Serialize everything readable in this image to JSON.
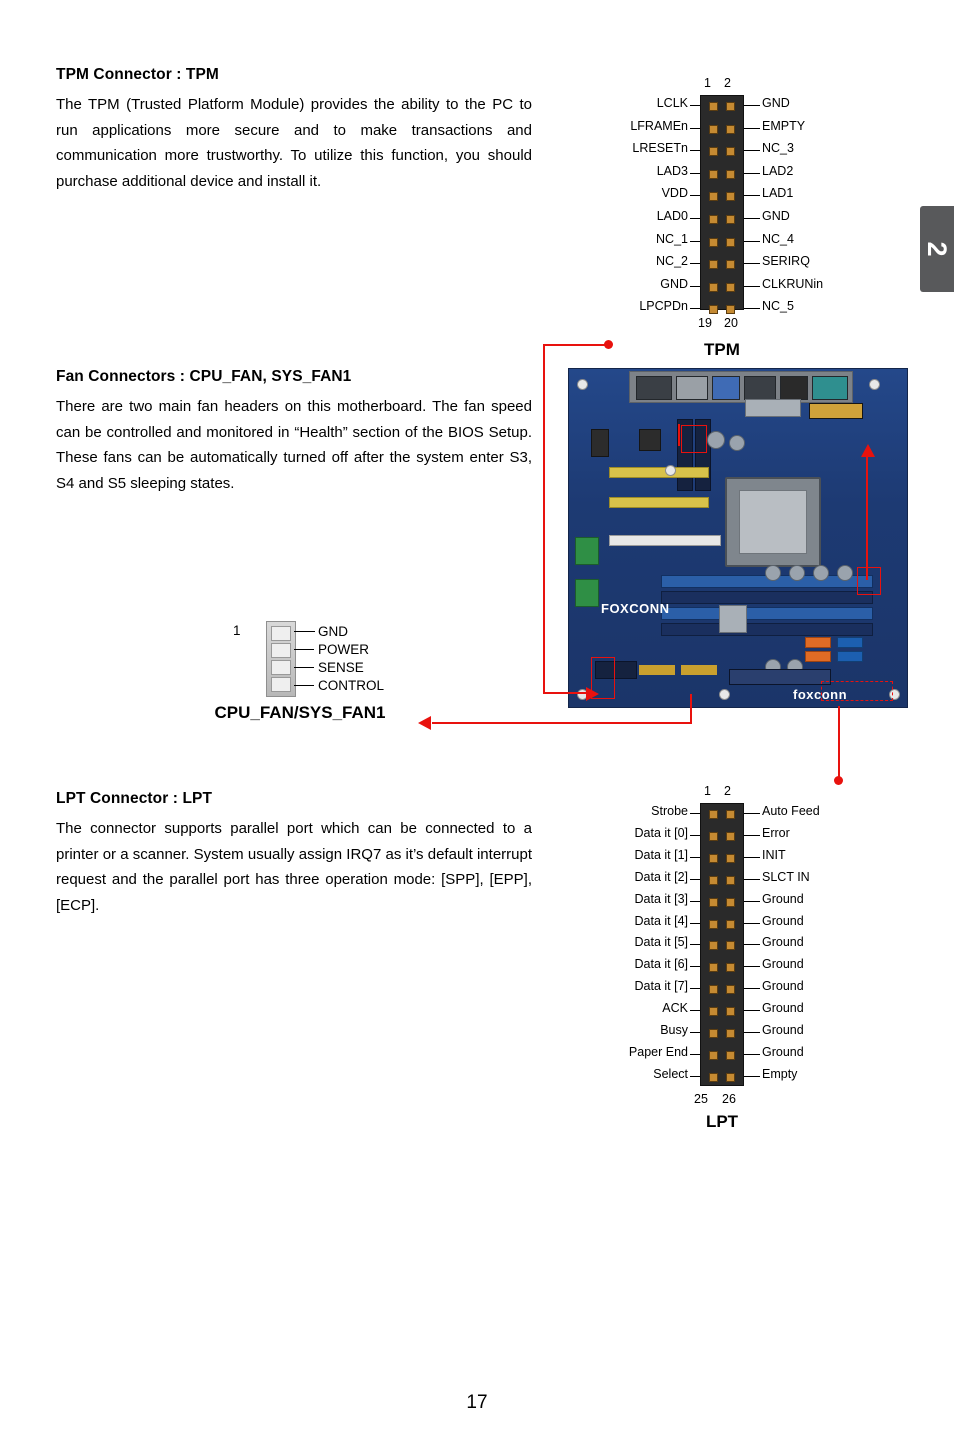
{
  "page": {
    "number": "17",
    "chapter_tab": "2"
  },
  "sections": [
    {
      "title": "TPM Connector : TPM",
      "body": "The TPM (Trusted Platform Module) provides the ability to the PC to run applications more secure and to make transactions and communication more trustworthy. To utilize this function, you should purchase additional device and install it."
    },
    {
      "title": "Fan Connectors : CPU_FAN, SYS_FAN1",
      "body": "There are two main fan headers on this motherboard. The fan speed can be controlled and monitored in “Health” section of the BIOS Setup. These fans can be automatically turned off after the system enter S3, S4 and S5 sleeping states."
    },
    {
      "title": "LPT Connector : LPT",
      "body": "The connector supports parallel port which can be connected to a printer or a scanner. System usually assign IRQ7 as it’s default interrupt request and the parallel port has three operation mode: [SPP], [EPP], [ECP]."
    }
  ],
  "tpm": {
    "caption": "TPM",
    "top_pins": [
      "1",
      "2"
    ],
    "bottom_pins": [
      "19",
      "20"
    ],
    "left_labels": [
      "LCLK",
      "LFRAMEn",
      "LRESETn",
      "LAD3",
      "VDD",
      "LAD0",
      "NC_1",
      "NC_2",
      "GND",
      "LPCPDn"
    ],
    "right_labels": [
      "GND",
      "EMPTY",
      "NC_3",
      "LAD2",
      "LAD1",
      "GND",
      "NC_4",
      "SERIRQ",
      "CLKRUNin",
      "NC_5"
    ]
  },
  "fan": {
    "caption": "CPU_FAN/SYS_FAN1",
    "pin1": "1",
    "labels": [
      "GND",
      "POWER",
      "SENSE",
      "CONTROL"
    ]
  },
  "lpt": {
    "caption": "LPT",
    "top_pins": [
      "1",
      "2"
    ],
    "bottom_pins": [
      "25",
      "26"
    ],
    "left_labels": [
      "Strobe",
      "Data it [0]",
      "Data it [1]",
      "Data it [2]",
      "Data it [3]",
      "Data it [4]",
      "Data it [5]",
      "Data it [6]",
      "Data it [7]",
      "ACK",
      "Busy",
      "Paper End",
      "Select"
    ],
    "right_labels": [
      "Auto Feed",
      "Error",
      "INIT",
      "SLCT IN",
      "Ground",
      "Ground",
      "Ground",
      "Ground",
      "Ground",
      "Ground",
      "Ground",
      "Ground",
      "Empty"
    ]
  },
  "motherboard": {
    "brand": "FOXCONN",
    "brand2": "foxconn"
  },
  "colors": {
    "highlight": "#e8120e",
    "tab_bg": "#58595b",
    "pin_gold": "#c58a32"
  }
}
